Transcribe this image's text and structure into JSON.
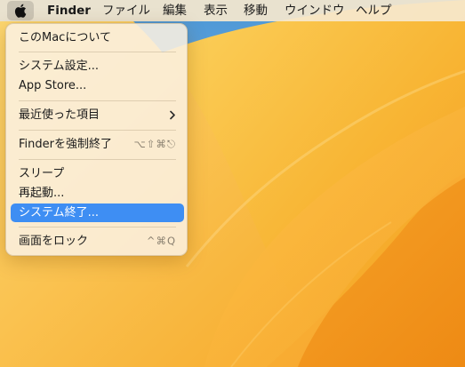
{
  "menubar": {
    "apple_icon": "apple-logo-icon",
    "app_name": "Finder",
    "items": [
      "ファイル",
      "編集",
      "表示",
      "移動",
      "ウインドウ",
      "ヘルプ"
    ]
  },
  "apple_menu": {
    "about": "このMacについて",
    "system_settings": "システム設定...",
    "app_store": "App Store...",
    "recent_items": "最近使った項目",
    "recent_items_icon": "chevron-right-icon",
    "force_quit": "Finderを強制終了",
    "force_quit_shortcut": "⌥⇧⌘⎋",
    "sleep": "スリープ",
    "restart": "再起動...",
    "shutdown": "システム終了...",
    "lock_screen": "画面をロック",
    "lock_screen_shortcut": "^⌘Q"
  },
  "colors": {
    "highlight": "#3e8ef3",
    "wallpaper_main": "#f7b93a",
    "wallpaper_sky": "#5ba4d8"
  }
}
